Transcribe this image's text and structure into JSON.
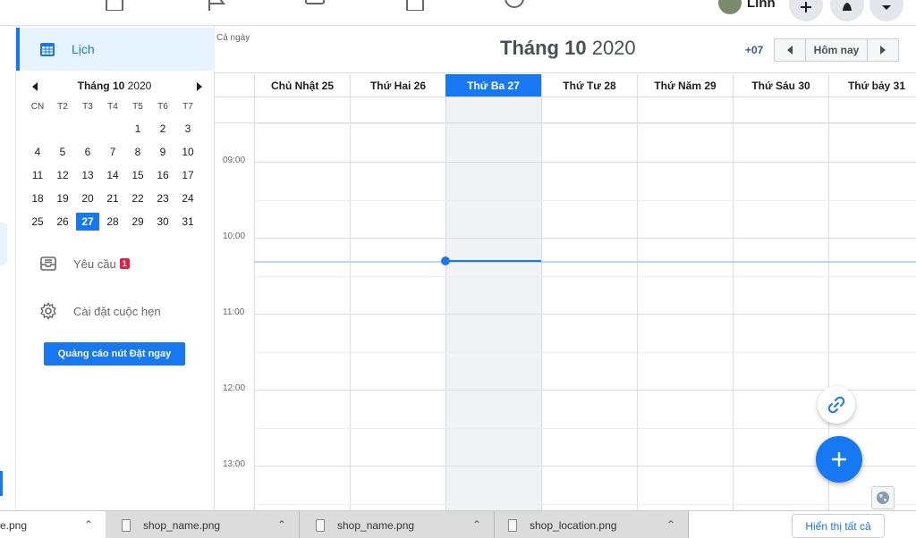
{
  "topnav": {
    "user_name": "Linh"
  },
  "sidebar": {
    "calendar_label": "Lịch",
    "requests_label": "Yêu cầu",
    "requests_badge": "1",
    "settings_label": "Cài đặt cuộc hẹn",
    "promo_button": "Quảng cáo nút Đặt ngay"
  },
  "mini_calendar": {
    "month_label": "Tháng 10",
    "year": "2020",
    "weekdays": [
      "CN",
      "T2",
      "T3",
      "T4",
      "T5",
      "T6",
      "T7"
    ],
    "days": [
      "",
      "",
      "",
      "",
      "1",
      "2",
      "3",
      "4",
      "5",
      "6",
      "7",
      "8",
      "9",
      "10",
      "11",
      "12",
      "13",
      "14",
      "15",
      "16",
      "17",
      "18",
      "19",
      "20",
      "21",
      "22",
      "23",
      "24",
      "25",
      "26",
      "27",
      "28",
      "29",
      "30",
      "31"
    ],
    "selected_day": "27"
  },
  "header": {
    "month": "Tháng 10",
    "year": "2020",
    "timezone": "+07",
    "today_button": "Hôm nay"
  },
  "week": {
    "days": [
      "Chủ Nhật 25",
      "Thứ Hai 26",
      "Thứ Ba 27",
      "Thứ Tư 28",
      "Thứ Năm 29",
      "Thứ Sáu 30",
      "Thứ bảy 31"
    ],
    "today_index": 2,
    "all_day_label": "Cả ngày",
    "hours": [
      "09:00",
      "10:00",
      "11:00",
      "12:00",
      "13:00"
    ]
  },
  "downloads": {
    "items": [
      "e.png",
      "shop_name.png",
      "shop_name.png",
      "shop_location.png"
    ],
    "show_all": "Hiển thị tất cả"
  },
  "colors": {
    "accent": "#1877f2",
    "badge": "#e41e3f",
    "today_column": "#f0f2f5"
  }
}
